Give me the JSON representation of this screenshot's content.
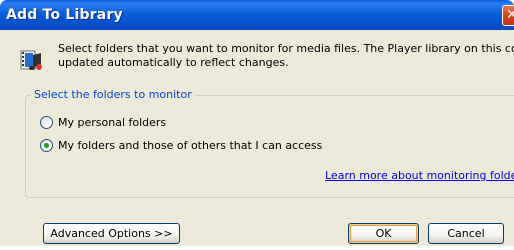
{
  "window": {
    "title": "Add To Library",
    "close_glyph": "✕"
  },
  "description": {
    "line1": "Select folders that you want to monitor for media files. The Player library on this computer is",
    "line2": "updated automatically to reflect changes.",
    "icon": "media-library-icon"
  },
  "group": {
    "legend": "Select the folders to monitor",
    "options": [
      {
        "label": "My personal folders",
        "selected": false
      },
      {
        "label": "My folders and those of others that I can access",
        "selected": true
      }
    ],
    "link": "Learn more about monitoring folders"
  },
  "buttons": {
    "advanced": "Advanced Options >>",
    "ok": "OK",
    "cancel": "Cancel"
  },
  "colors": {
    "titlebar": "#0a5fd8",
    "dialog_bg": "#ece9d8",
    "legend_text": "#0046d5",
    "link": "#0000ee",
    "close": "#d4431e"
  }
}
